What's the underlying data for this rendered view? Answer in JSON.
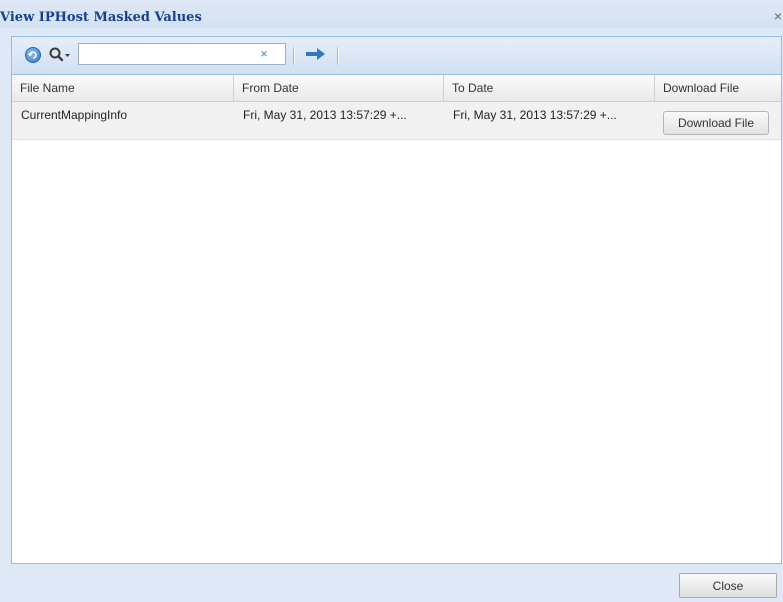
{
  "dialog": {
    "title": "View IPHost Masked Values",
    "close_glyph": "×"
  },
  "toolbar": {
    "refresh_icon": "refresh-icon",
    "search_icon": "search-icon",
    "search_value": "",
    "clear_glyph": "×",
    "go_icon": "arrow-right-icon"
  },
  "grid": {
    "columns": [
      "File Name",
      "From Date",
      "To Date",
      "Download File"
    ],
    "rows": [
      {
        "file_name": "CurrentMappingInfo",
        "from_date": "Fri, May 31, 2013 13:57:29 +...",
        "to_date": "Fri, May 31, 2013 13:57:29 +...",
        "download_label": "Download File"
      }
    ]
  },
  "footer": {
    "close_label": "Close"
  },
  "colors": {
    "window_bg": "#dfe8f6",
    "title_text": "#15428b",
    "panel_border": "#99bbe8",
    "row_bg": "#f1f1f1",
    "accent_blue": "#2f78c8"
  }
}
